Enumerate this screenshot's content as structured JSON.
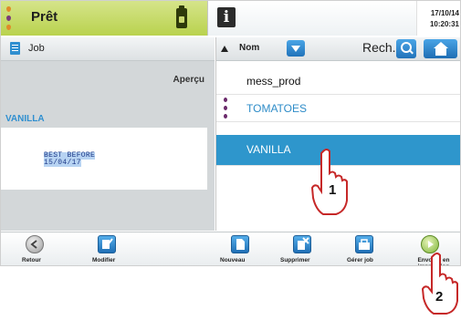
{
  "status": {
    "title": "Prêt",
    "date": "17/10/14",
    "time": "10:20:31",
    "drop_colors": [
      "#e08a2a",
      "#7a3b7a",
      "#e08a2a"
    ]
  },
  "left": {
    "job_label": "Job",
    "apercu_label": "Aperçu",
    "message_name": "VANILLA",
    "preview_lines": [
      "BEST BEFORE",
      "15/04/17"
    ]
  },
  "right": {
    "sort_label": "Nom",
    "search_label": "Rech.",
    "items": [
      {
        "name": "mess_prod",
        "color": "#111111",
        "selected": false
      },
      {
        "name": "TOMATOES",
        "color": "#2e8cc8",
        "selected": false
      },
      {
        "name": "VANILLA",
        "color": "#ffffff",
        "selected": true
      }
    ]
  },
  "toolbar": {
    "retour": "Retour",
    "modifier": "Modifier",
    "nouveau": "Nouveau",
    "supprimer": "Supprimer",
    "gerer": "Gérer job",
    "envoyer": "Envoyer en impression"
  },
  "callouts": {
    "one": "1",
    "two": "2"
  },
  "colors": {
    "status_green": "#c7db6a",
    "accent_blue": "#2e96cc",
    "panel_gray": "#d3d7d9"
  }
}
